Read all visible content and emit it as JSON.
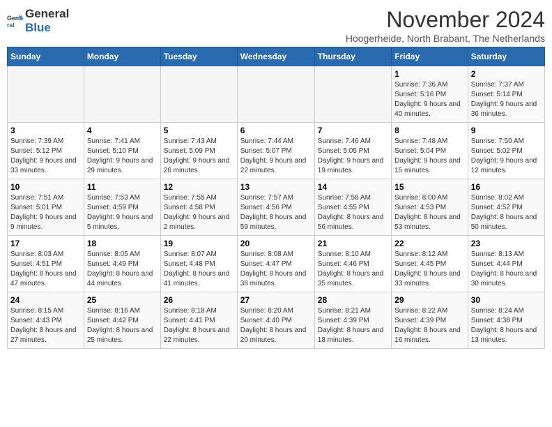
{
  "logo": {
    "general": "General",
    "blue": "Blue"
  },
  "title": "November 2024",
  "subtitle": "Hoogerheide, North Brabant, The Netherlands",
  "days_of_week": [
    "Sunday",
    "Monday",
    "Tuesday",
    "Wednesday",
    "Thursday",
    "Friday",
    "Saturday"
  ],
  "weeks": [
    [
      {
        "day": "",
        "info": ""
      },
      {
        "day": "",
        "info": ""
      },
      {
        "day": "",
        "info": ""
      },
      {
        "day": "",
        "info": ""
      },
      {
        "day": "",
        "info": ""
      },
      {
        "day": "1",
        "info": "Sunrise: 7:36 AM\nSunset: 5:16 PM\nDaylight: 9 hours and 40 minutes."
      },
      {
        "day": "2",
        "info": "Sunrise: 7:37 AM\nSunset: 5:14 PM\nDaylight: 9 hours and 36 minutes."
      }
    ],
    [
      {
        "day": "3",
        "info": "Sunrise: 7:39 AM\nSunset: 5:12 PM\nDaylight: 9 hours and 33 minutes."
      },
      {
        "day": "4",
        "info": "Sunrise: 7:41 AM\nSunset: 5:10 PM\nDaylight: 9 hours and 29 minutes."
      },
      {
        "day": "5",
        "info": "Sunrise: 7:43 AM\nSunset: 5:09 PM\nDaylight: 9 hours and 26 minutes."
      },
      {
        "day": "6",
        "info": "Sunrise: 7:44 AM\nSunset: 5:07 PM\nDaylight: 9 hours and 22 minutes."
      },
      {
        "day": "7",
        "info": "Sunrise: 7:46 AM\nSunset: 5:05 PM\nDaylight: 9 hours and 19 minutes."
      },
      {
        "day": "8",
        "info": "Sunrise: 7:48 AM\nSunset: 5:04 PM\nDaylight: 9 hours and 15 minutes."
      },
      {
        "day": "9",
        "info": "Sunrise: 7:50 AM\nSunset: 5:02 PM\nDaylight: 9 hours and 12 minutes."
      }
    ],
    [
      {
        "day": "10",
        "info": "Sunrise: 7:51 AM\nSunset: 5:01 PM\nDaylight: 9 hours and 9 minutes."
      },
      {
        "day": "11",
        "info": "Sunrise: 7:53 AM\nSunset: 4:59 PM\nDaylight: 9 hours and 5 minutes."
      },
      {
        "day": "12",
        "info": "Sunrise: 7:55 AM\nSunset: 4:58 PM\nDaylight: 9 hours and 2 minutes."
      },
      {
        "day": "13",
        "info": "Sunrise: 7:57 AM\nSunset: 4:56 PM\nDaylight: 8 hours and 59 minutes."
      },
      {
        "day": "14",
        "info": "Sunrise: 7:58 AM\nSunset: 4:55 PM\nDaylight: 8 hours and 56 minutes."
      },
      {
        "day": "15",
        "info": "Sunrise: 8:00 AM\nSunset: 4:53 PM\nDaylight: 8 hours and 53 minutes."
      },
      {
        "day": "16",
        "info": "Sunrise: 8:02 AM\nSunset: 4:52 PM\nDaylight: 8 hours and 50 minutes."
      }
    ],
    [
      {
        "day": "17",
        "info": "Sunrise: 8:03 AM\nSunset: 4:51 PM\nDaylight: 8 hours and 47 minutes."
      },
      {
        "day": "18",
        "info": "Sunrise: 8:05 AM\nSunset: 4:49 PM\nDaylight: 8 hours and 44 minutes."
      },
      {
        "day": "19",
        "info": "Sunrise: 8:07 AM\nSunset: 4:48 PM\nDaylight: 8 hours and 41 minutes."
      },
      {
        "day": "20",
        "info": "Sunrise: 8:08 AM\nSunset: 4:47 PM\nDaylight: 8 hours and 38 minutes."
      },
      {
        "day": "21",
        "info": "Sunrise: 8:10 AM\nSunset: 4:46 PM\nDaylight: 8 hours and 35 minutes."
      },
      {
        "day": "22",
        "info": "Sunrise: 8:12 AM\nSunset: 4:45 PM\nDaylight: 8 hours and 33 minutes."
      },
      {
        "day": "23",
        "info": "Sunrise: 8:13 AM\nSunset: 4:44 PM\nDaylight: 8 hours and 30 minutes."
      }
    ],
    [
      {
        "day": "24",
        "info": "Sunrise: 8:15 AM\nSunset: 4:43 PM\nDaylight: 8 hours and 27 minutes."
      },
      {
        "day": "25",
        "info": "Sunrise: 8:16 AM\nSunset: 4:42 PM\nDaylight: 8 hours and 25 minutes."
      },
      {
        "day": "26",
        "info": "Sunrise: 8:18 AM\nSunset: 4:41 PM\nDaylight: 8 hours and 22 minutes."
      },
      {
        "day": "27",
        "info": "Sunrise: 8:20 AM\nSunset: 4:40 PM\nDaylight: 8 hours and 20 minutes."
      },
      {
        "day": "28",
        "info": "Sunrise: 8:21 AM\nSunset: 4:39 PM\nDaylight: 8 hours and 18 minutes."
      },
      {
        "day": "29",
        "info": "Sunrise: 8:22 AM\nSunset: 4:39 PM\nDaylight: 8 hours and 16 minutes."
      },
      {
        "day": "30",
        "info": "Sunrise: 8:24 AM\nSunset: 4:38 PM\nDaylight: 8 hours and 13 minutes."
      }
    ]
  ]
}
